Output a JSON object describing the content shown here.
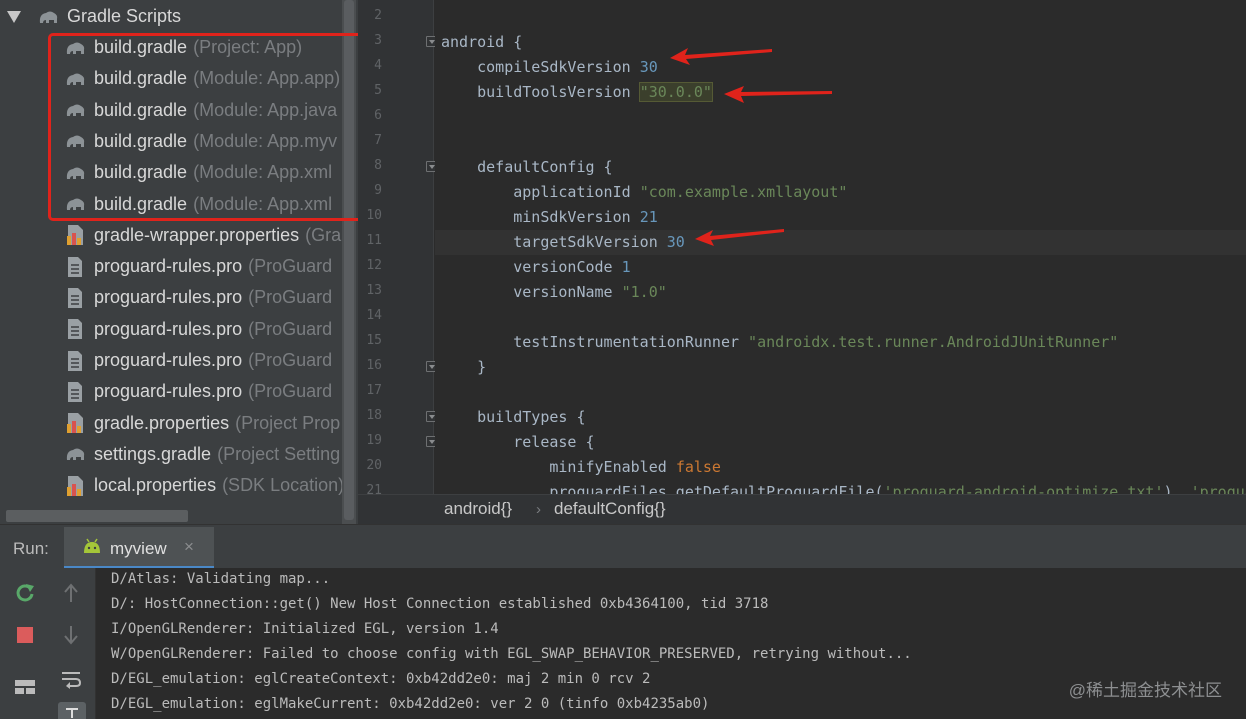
{
  "project_tree": {
    "header_label": "Gradle Scripts",
    "items": [
      {
        "name": "build.gradle",
        "hint": "(Project: App)",
        "icon": "gradle-elephant-icon"
      },
      {
        "name": "build.gradle",
        "hint": "(Module: App.app)",
        "icon": "gradle-elephant-icon"
      },
      {
        "name": "build.gradle",
        "hint": "(Module: App.java",
        "icon": "gradle-elephant-icon"
      },
      {
        "name": "build.gradle",
        "hint": "(Module: App.myv",
        "icon": "gradle-elephant-icon"
      },
      {
        "name": "build.gradle",
        "hint": "(Module: App.xml",
        "icon": "gradle-elephant-icon"
      },
      {
        "name": "build.gradle",
        "hint": "(Module: App.xml",
        "icon": "gradle-elephant-icon"
      },
      {
        "name": "gradle-wrapper.properties",
        "hint": "(Gra",
        "icon": "properties-file-icon"
      },
      {
        "name": "proguard-rules.pro",
        "hint": "(ProGuard",
        "icon": "text-file-icon"
      },
      {
        "name": "proguard-rules.pro",
        "hint": "(ProGuard",
        "icon": "text-file-icon"
      },
      {
        "name": "proguard-rules.pro",
        "hint": "(ProGuard",
        "icon": "text-file-icon"
      },
      {
        "name": "proguard-rules.pro",
        "hint": "(ProGuard",
        "icon": "text-file-icon"
      },
      {
        "name": "proguard-rules.pro",
        "hint": "(ProGuard",
        "icon": "text-file-icon"
      },
      {
        "name": "gradle.properties",
        "hint": "(Project Prop",
        "icon": "properties-file-icon"
      },
      {
        "name": "settings.gradle",
        "hint": "(Project Setting",
        "icon": "gradle-elephant-icon"
      },
      {
        "name": "local.properties",
        "hint": "(SDK Location)",
        "icon": "properties-file-icon"
      }
    ]
  },
  "editor": {
    "line_numbers": [
      "2",
      "3",
      "4",
      "5",
      "6",
      "7",
      "8",
      "9",
      "10",
      "11",
      "12",
      "13",
      "14",
      "15",
      "16",
      "17",
      "18",
      "19",
      "20",
      "21"
    ],
    "code": {
      "l3_a": "android {",
      "l4_a": "    compileSdkVersion ",
      "l4_b": "30",
      "l5_a": "    buildToolsVersion ",
      "l5_b": "\"30.0.0\"",
      "l8_a": "    defaultConfig {",
      "l9_a": "        applicationId ",
      "l9_b": "\"com.example.xmllayout\"",
      "l10_a": "        minSdkVersion ",
      "l10_b": "21",
      "l11_a": "        targetSdkVersion ",
      "l11_b": "30",
      "l12_a": "        versionCode ",
      "l12_b": "1",
      "l13_a": "        versionName ",
      "l13_b": "\"1.0\"",
      "l15_a": "        testInstrumentationRunner ",
      "l15_b": "\"androidx.test.runner.AndroidJUnitRunner\"",
      "l16_a": "    }",
      "l18_a": "    buildTypes {",
      "l19_a": "        release {",
      "l20_a": "            minifyEnabled ",
      "l20_b": "false",
      "l21_a": "            proguardFiles getDefaultProguardFile(",
      "l21_b": "'proguard-android-optimize.txt'",
      "l21_c": "), ",
      "l21_d": "'proguar"
    }
  },
  "breadcrumb": {
    "first": "android{}",
    "second": "defaultConfig{}"
  },
  "run_panel": {
    "label": "Run:",
    "tab": "myview",
    "tab_close": "×",
    "lines": [
      "D/Atlas: Validating map...",
      "D/: HostConnection::get() New Host Connection established 0xb4364100, tid 3718",
      "I/OpenGLRenderer: Initialized EGL, version 1.4",
      "W/OpenGLRenderer: Failed to choose config with EGL_SWAP_BEHAVIOR_PRESERVED, retrying without...",
      "D/EGL_emulation: eglCreateContext: 0xb42dd2e0: maj 2 min 0 rcv 2",
      "D/EGL_emulation: eglMakeCurrent: 0xb42dd2e0: ver 2 0 (tinfo 0xb4235ab0)"
    ]
  },
  "watermark": "@稀土掘金技术社区",
  "colors": {
    "annotation_red": "#e0231b",
    "tab_accent": "#4a88c7",
    "android_green": "#a4c639"
  }
}
